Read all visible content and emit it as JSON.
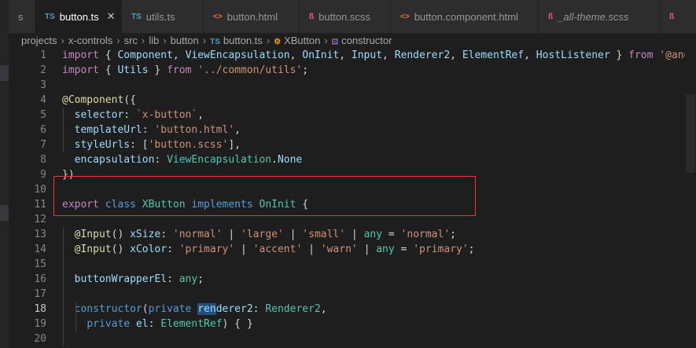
{
  "tabs": [
    {
      "icon": "",
      "label": "s",
      "active": false,
      "italic": false,
      "icon_color": "#969696"
    },
    {
      "icon": "TS",
      "label": "button.ts",
      "active": true,
      "italic": false,
      "icon_color": "#519aba",
      "close": "✕"
    },
    {
      "icon": "TS",
      "label": "utils.ts",
      "active": false,
      "italic": false,
      "icon_color": "#519aba"
    },
    {
      "icon": "<>",
      "label": "button.html",
      "active": false,
      "italic": false,
      "icon_color": "#e37933"
    },
    {
      "icon": "ß",
      "label": "button.scss",
      "active": false,
      "italic": false,
      "icon_color": "#f55385"
    },
    {
      "icon": "<>",
      "label": "button.component.html",
      "active": false,
      "italic": false,
      "icon_color": "#e37933"
    },
    {
      "icon": "ß",
      "label": "_all-theme.scss",
      "active": false,
      "italic": true,
      "icon_color": "#f55385"
    },
    {
      "icon": "ß",
      "label": "",
      "active": false,
      "italic": false,
      "icon_color": "#f55385"
    }
  ],
  "breadcrumb": {
    "items": [
      "projects",
      "x-controls",
      "src",
      "lib",
      "button"
    ],
    "file_icon": "TS",
    "file": "button.ts",
    "class_icon": "⚙",
    "class": "XButton",
    "member_icon": "⊡",
    "member": "constructor",
    "separator": "›"
  },
  "editor": {
    "current_line": 18,
    "line_numbers": [
      1,
      2,
      3,
      4,
      5,
      6,
      7,
      8,
      9,
      10,
      11,
      12,
      13,
      14,
      15,
      16,
      17,
      18,
      19,
      20
    ],
    "lines": [
      [
        [
          "kw2",
          "import"
        ],
        [
          "punc",
          " { "
        ],
        [
          "var",
          "Component"
        ],
        [
          "punc",
          ", "
        ],
        [
          "var",
          "ViewEncapsulation"
        ],
        [
          "punc",
          ", "
        ],
        [
          "var",
          "OnInit"
        ],
        [
          "punc",
          ", "
        ],
        [
          "var",
          "Input"
        ],
        [
          "punc",
          ", "
        ],
        [
          "var",
          "Renderer2"
        ],
        [
          "punc",
          ", "
        ],
        [
          "var",
          "ElementRef"
        ],
        [
          "punc",
          ", "
        ],
        [
          "var",
          "HostListener"
        ],
        [
          "punc",
          " } "
        ],
        [
          "kw2",
          "from"
        ],
        [
          "punc",
          " "
        ],
        [
          "str",
          "'@angula"
        ]
      ],
      [
        [
          "kw2",
          "import"
        ],
        [
          "punc",
          " { "
        ],
        [
          "var",
          "Utils"
        ],
        [
          "punc",
          " } "
        ],
        [
          "kw2",
          "from"
        ],
        [
          "punc",
          " "
        ],
        [
          "str",
          "'../common/utils'"
        ],
        [
          "punc",
          ";"
        ]
      ],
      [],
      [
        [
          "dec",
          "@Component"
        ],
        [
          "punc",
          "({"
        ]
      ],
      [
        [
          "punc",
          "  "
        ],
        [
          "var",
          "selector"
        ],
        [
          "punc",
          ": "
        ],
        [
          "str",
          "`x-button`"
        ],
        [
          "punc",
          ","
        ]
      ],
      [
        [
          "punc",
          "  "
        ],
        [
          "var",
          "templateUrl"
        ],
        [
          "punc",
          ": "
        ],
        [
          "str",
          "'button.html'"
        ],
        [
          "punc",
          ","
        ]
      ],
      [
        [
          "punc",
          "  "
        ],
        [
          "var",
          "styleUrls"
        ],
        [
          "punc",
          ": ["
        ],
        [
          "str",
          "'button.scss'"
        ],
        [
          "punc",
          "],"
        ]
      ],
      [
        [
          "punc",
          "  "
        ],
        [
          "var",
          "encapsulation"
        ],
        [
          "punc",
          ": "
        ],
        [
          "type",
          "ViewEncapsulation"
        ],
        [
          "punc",
          "."
        ],
        [
          "var",
          "None"
        ]
      ],
      [
        [
          "punc",
          "})"
        ]
      ],
      [],
      [
        [
          "kw2",
          "export"
        ],
        [
          "punc",
          " "
        ],
        [
          "kw",
          "class"
        ],
        [
          "punc",
          " "
        ],
        [
          "type",
          "XButton"
        ],
        [
          "punc",
          " "
        ],
        [
          "kw",
          "implements"
        ],
        [
          "punc",
          " "
        ],
        [
          "type",
          "OnInit"
        ],
        [
          "punc",
          " {"
        ]
      ],
      [],
      [
        [
          "punc",
          "  "
        ],
        [
          "dec",
          "@Input"
        ],
        [
          "punc",
          "() "
        ],
        [
          "var",
          "xSize"
        ],
        [
          "punc",
          ": "
        ],
        [
          "str",
          "'normal'"
        ],
        [
          "punc",
          " | "
        ],
        [
          "str",
          "'large'"
        ],
        [
          "punc",
          " | "
        ],
        [
          "str",
          "'small'"
        ],
        [
          "punc",
          " | "
        ],
        [
          "type",
          "any"
        ],
        [
          "punc",
          " = "
        ],
        [
          "str",
          "'normal'"
        ],
        [
          "punc",
          ";"
        ]
      ],
      [
        [
          "punc",
          "  "
        ],
        [
          "dec",
          "@Input"
        ],
        [
          "punc",
          "() "
        ],
        [
          "var",
          "xColor"
        ],
        [
          "punc",
          ": "
        ],
        [
          "str",
          "'primary'"
        ],
        [
          "punc",
          " | "
        ],
        [
          "str",
          "'accent'"
        ],
        [
          "punc",
          " | "
        ],
        [
          "str",
          "'warn'"
        ],
        [
          "punc",
          " | "
        ],
        [
          "type",
          "any"
        ],
        [
          "punc",
          " = "
        ],
        [
          "str",
          "'primary'"
        ],
        [
          "punc",
          ";"
        ]
      ],
      [],
      [
        [
          "punc",
          "  "
        ],
        [
          "var",
          "buttonWrapperEl"
        ],
        [
          "punc",
          ": "
        ],
        [
          "type",
          "any"
        ],
        [
          "punc",
          ";"
        ]
      ],
      [],
      [
        [
          "punc",
          "  "
        ],
        [
          "kw",
          "constructor"
        ],
        [
          "punc",
          "("
        ],
        [
          "kw",
          "private"
        ],
        [
          "punc",
          " "
        ],
        [
          "sel",
          "ren"
        ],
        [
          "var",
          "derer2"
        ],
        [
          "punc",
          ": "
        ],
        [
          "type",
          "Renderer2"
        ],
        [
          "punc",
          ","
        ]
      ],
      [
        [
          "punc",
          "    "
        ],
        [
          "kw",
          "private"
        ],
        [
          "punc",
          " "
        ],
        [
          "var",
          "el"
        ],
        [
          "punc",
          ": "
        ],
        [
          "type",
          "ElementRef"
        ],
        [
          "punc",
          ") { }"
        ]
      ],
      []
    ]
  },
  "colors": {
    "background": "#1e1e1e",
    "highlight_box": "#e53935",
    "keyword": "#569cd6",
    "control_keyword": "#c586c0",
    "string": "#ce9178",
    "type": "#4ec9b0",
    "variable": "#9cdcfe",
    "decorator": "#dcdcaa"
  }
}
